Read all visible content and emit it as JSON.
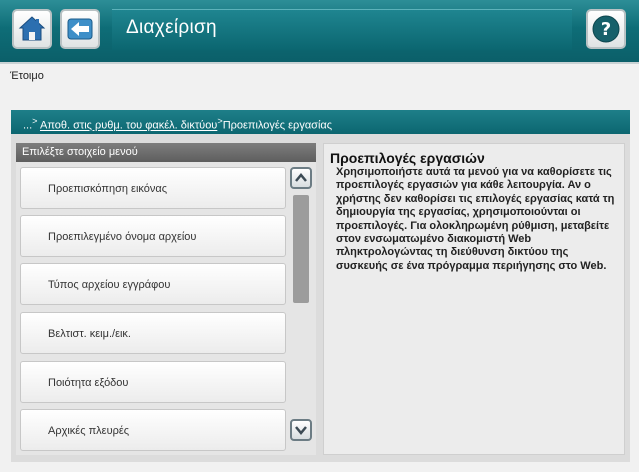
{
  "header": {
    "title": "Διαχείριση",
    "home_icon": "home-icon",
    "back_icon": "back-arrow-icon",
    "help_icon": "help-question-icon",
    "accent_color": "#0e6d77"
  },
  "status": {
    "text": "Έτοιμο"
  },
  "breadcrumb": {
    "prefix": "...",
    "sep1": ">",
    "link": "Αποθ. στις ρυθμ. του φακέλ. δικτύου",
    "sep2": ">",
    "current": "Προεπιλογές εργασίας"
  },
  "menu": {
    "header": "Επιλέξτε στοιχείο μενού",
    "items": [
      {
        "label": "Προεπισκόπηση εικόνας"
      },
      {
        "label": "Προεπιλεγμένο όνομα αρχείου"
      },
      {
        "label": "Τύπος αρχείου εγγράφου"
      },
      {
        "label": "Βελτιστ. κειμ./εικ."
      },
      {
        "label": "Ποιότητα εξόδου"
      },
      {
        "label": "Αρχικές πλευρές"
      }
    ],
    "scroll_up_icon": "chevron-up-icon",
    "scroll_down_icon": "chevron-down-icon"
  },
  "info": {
    "title": "Προεπιλογές εργασιών",
    "body": "Χρησιμοποιήστε αυτά τα μενού για να καθορίσετε τις προεπιλογές εργασιών για κάθε λειτουργία. Αν ο χρήστης δεν καθορίσει τις επιλογές εργασίας κατά τη δημιουργία της εργασίας, χρησιμοποιούνται οι προεπιλογές. Για ολοκληρωμένη ρύθμιση, μεταβείτε στον ενσωματωμένο διακομιστή Web πληκτρολογώντας τη διεύθυνση δικτύου της συσκευής σε ένα πρόγραμμα περιήγησης στο Web."
  }
}
